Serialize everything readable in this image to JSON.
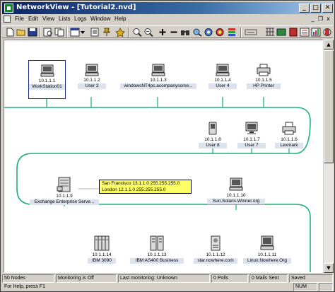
{
  "window": {
    "title": "NetworkView - [Tutorial2.nvd]",
    "min_label": "_",
    "max_label": "□",
    "close_label": "✕"
  },
  "menu": {
    "items": [
      "File",
      "Edit",
      "View",
      "Lists",
      "Logs",
      "Window",
      "Help"
    ],
    "min_label": "_",
    "restore_label": "❐",
    "close_label": "x"
  },
  "toolbar": {
    "buttons": [
      "new-icon",
      "open-icon",
      "save-icon",
      "print-preview-icon",
      "copy-icon",
      "layout-icon",
      "dropdown-icon",
      "properties-icon",
      "pin-icon",
      "zoom-in-icon",
      "zoom-out-icon",
      "add-icon",
      "remove-icon",
      "find-icon",
      "discover-icon",
      "ping-icon",
      "graph-icon",
      "settings-icon",
      "list-icon",
      "monitor-icon",
      "log-icon",
      "book-icon",
      "tools-icon",
      "chart-icon",
      "help-icon"
    ]
  },
  "network": {
    "row1": [
      {
        "ip": "10.1.1.1",
        "name": "WorkStation01",
        "type": "workstation"
      },
      {
        "ip": "10.1.1.2",
        "name": "User 2",
        "type": "workstation"
      },
      {
        "ip": "10.1.1.3",
        "name": "windowsNT4pc.acompanysome...",
        "type": "workstation"
      },
      {
        "ip": "10.1.1.4",
        "name": "User 4",
        "type": "workstation"
      },
      {
        "ip": "10.1.1.5",
        "name": "HP Printer",
        "type": "printer"
      }
    ],
    "row2": [
      {
        "ip": "10.1.1.8",
        "name": "User 8",
        "type": "handheld"
      },
      {
        "ip": "10.1.1.7",
        "name": "User 7",
        "type": "workstation"
      },
      {
        "ip": "10.1.1.6",
        "name": "Lexmark",
        "type": "printer"
      }
    ],
    "row3": [
      {
        "ip": "10.1.1.9",
        "name": "Exchange Enterprise Serve...",
        "type": "server"
      },
      {
        "ip": "10.1.1.10",
        "name": "Sun.Solaris.Winner.org",
        "type": "workstation"
      }
    ],
    "row4": [
      {
        "ip": "10.1.1.14",
        "name": "IBM 3090",
        "type": "mainframe"
      },
      {
        "ip": "10.1.1.13",
        "name": "IBM AS400 Business",
        "type": "as400"
      },
      {
        "ip": "10.1.1.12",
        "name": "star.nowhere.com",
        "type": "device"
      },
      {
        "ip": "10.1.1.11",
        "name": "Linux.Nowhere.Org",
        "type": "workstation"
      }
    ],
    "tooltip": {
      "line1": "San Francisco 13.1.1.0 255.255.255.0",
      "line2": "London 12.1.1.0 255.255.255.0"
    },
    "bus_color": "#22b07a"
  },
  "status": {
    "nodes": "50 Nodes",
    "monitoring": "Monitoring is Off",
    "last_monitoring": "Last monitoring: Unknown",
    "polls": "0 Polls",
    "mails": "0 Mails Sent",
    "saved": "Saved"
  },
  "help": {
    "text": "For Help, press F1",
    "num": "NUM"
  }
}
